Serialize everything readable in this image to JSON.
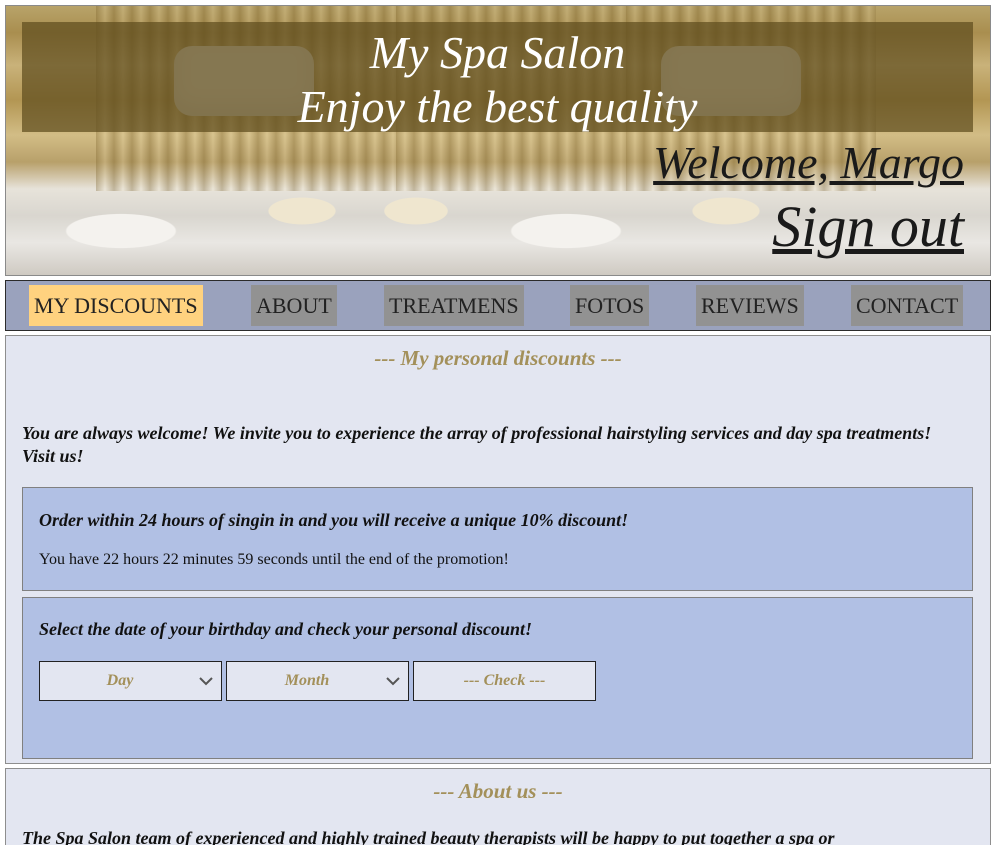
{
  "header": {
    "title": "My Spa Salon",
    "tagline": "Enjoy the best quality",
    "welcome": "Welcome, Margo",
    "sign_out": "Sign out"
  },
  "nav": {
    "items": [
      {
        "label": "MY DISCOUNTS",
        "active": true
      },
      {
        "label": "ABOUT",
        "active": false
      },
      {
        "label": "TREATMENS",
        "active": false
      },
      {
        "label": "FOTOS",
        "active": false
      },
      {
        "label": "REVIEWS",
        "active": false
      },
      {
        "label": "CONTACT",
        "active": false
      }
    ]
  },
  "discounts": {
    "heading": "--- My personal discounts ---",
    "intro": "You are always welcome! We invite you to experience the array of professional hairstyling services and day spa treatments! Visit us!",
    "promo": {
      "title": "Order within 24 hours of singin in and you will receive a unique 10% discount!",
      "countdown": "You have 22 hours 22 minutes 59 seconds until the end of the promotion!"
    },
    "birthday": {
      "title": "Select the date of your birthday and check your personal discount!",
      "day_select": "Day",
      "month_select": "Month",
      "check_button": "--- Check ---"
    }
  },
  "about": {
    "heading": "--- About us ---",
    "text": "The Spa Salon team of experienced and highly trained beauty therapists will be happy to put together a spa or"
  },
  "colors": {
    "nav_bg": "#9aa2bd",
    "nav_item_bg": "#929292",
    "nav_active_bg": "#ffd27f",
    "panel_bg": "#e3e6f1",
    "box_bg": "#b1c0e4",
    "heading_gold": "#a3905a"
  },
  "icons": {
    "select_arrow": "chevron-down-icon"
  }
}
